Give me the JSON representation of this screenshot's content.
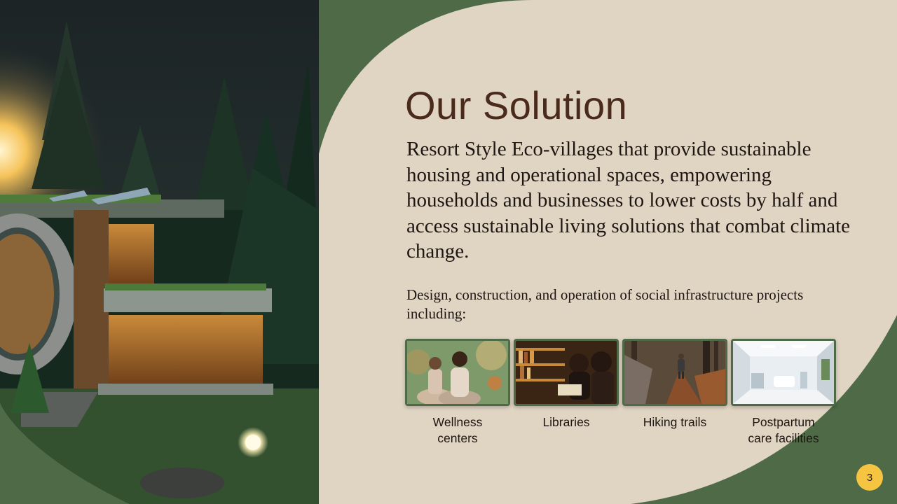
{
  "slide": {
    "title": "Our Solution",
    "lead": "Resort Style Eco-villages that provide sustainable housing and operational spaces, empowering households and businesses to lower costs by half and access sustainable living solutions that combat climate change.",
    "subheading": "Design, construction, and operation of social infrastructure projects including:",
    "projects": [
      {
        "line1": "Wellness",
        "line2": "centers"
      },
      {
        "line1": "Libraries",
        "line2": ""
      },
      {
        "line1": "Hiking trails",
        "line2": ""
      },
      {
        "line1": "Postpartum",
        "line2": "care facilities"
      }
    ],
    "page_number": "3"
  },
  "colors": {
    "background_green": "#4e6a46",
    "panel_beige": "#e0d4c3",
    "title_brown": "#4a2a1a",
    "badge_yellow": "#f5c542"
  }
}
